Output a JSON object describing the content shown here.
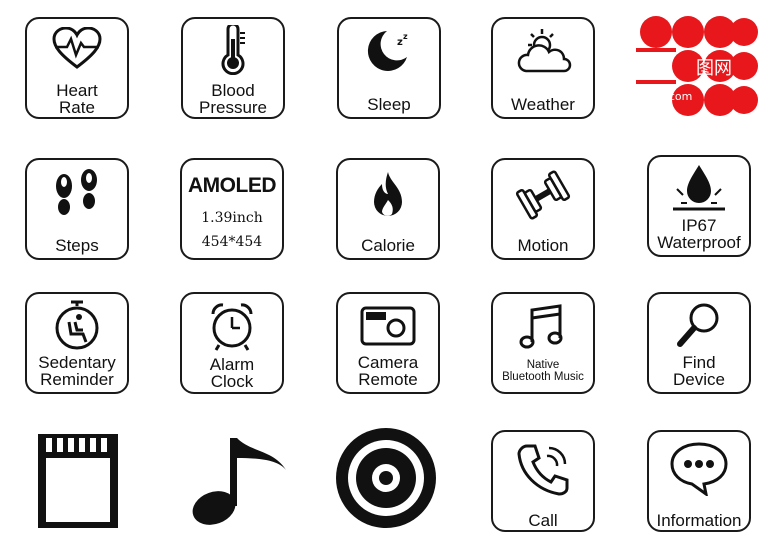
{
  "features": {
    "heart_rate": {
      "line1": "Heart",
      "line2": "Rate"
    },
    "blood_pressure": {
      "line1": "Blood",
      "line2": "Pressure"
    },
    "sleep": {
      "label": "Sleep"
    },
    "weather": {
      "label": "Weather"
    },
    "steps": {
      "label": "Steps"
    },
    "amoled": {
      "title": "AMOLED",
      "size": "1.39inch",
      "resolution": "454*454"
    },
    "calorie": {
      "label": "Calorie"
    },
    "motion": {
      "label": "Motion"
    },
    "waterproof": {
      "line1": "IP67",
      "line2": "Waterproof"
    },
    "sedentary": {
      "line1": "Sedentary",
      "line2": "Reminder"
    },
    "alarm": {
      "line1": "Alarm",
      "line2": "Clock"
    },
    "camera": {
      "line1": "Camera",
      "line2": "Remote"
    },
    "music": {
      "line1": "Native",
      "line2": "Bluetooth Music"
    },
    "find": {
      "line1": "Find",
      "line2": "Device"
    },
    "call": {
      "label": "Call"
    },
    "information": {
      "label": "Information"
    }
  },
  "watermark": {
    "text": "图网",
    "url": "ikutu.com"
  },
  "colors": {
    "border": "#1a1a1a",
    "logo_red": "#e8171c",
    "icon": "#111111"
  }
}
